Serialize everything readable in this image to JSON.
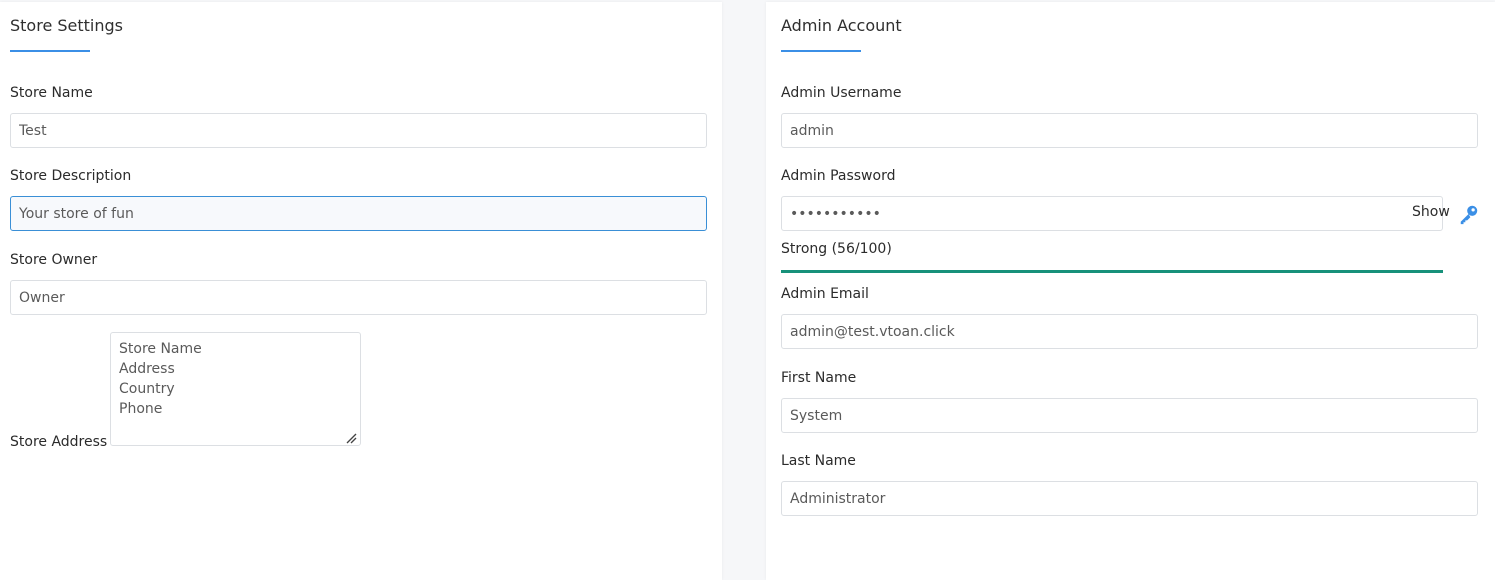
{
  "store_settings": {
    "title": "Store Settings",
    "store_name": {
      "label": "Store Name",
      "value": "Test"
    },
    "store_description": {
      "label": "Store Description",
      "value": "Your store of fun"
    },
    "store_owner": {
      "label": "Store Owner",
      "value": "Owner"
    },
    "store_address": {
      "label": "Store Address",
      "value": "Store Name\nAddress\nCountry\nPhone"
    }
  },
  "admin_account": {
    "title": "Admin Account",
    "admin_username": {
      "label": "Admin Username",
      "value": "admin"
    },
    "admin_password": {
      "label": "Admin Password",
      "value": "•••••••••••",
      "show_label": "Show",
      "strength_text": "Strong (56/100)",
      "strength_score": 56
    },
    "admin_email": {
      "label": "Admin Email",
      "value": "admin@test.vtoan.click"
    },
    "first_name": {
      "label": "First Name",
      "value": "System"
    },
    "last_name": {
      "label": "Last Name",
      "value": "Administrator"
    }
  },
  "colors": {
    "accent": "#3b8fe6",
    "strength_bar": "#17917a",
    "focus_border": "#3a8fd6",
    "key_icon": "#3b8fe6"
  },
  "icons": {
    "password_action": "key-icon",
    "textarea_resize": "resize-grip-icon"
  }
}
